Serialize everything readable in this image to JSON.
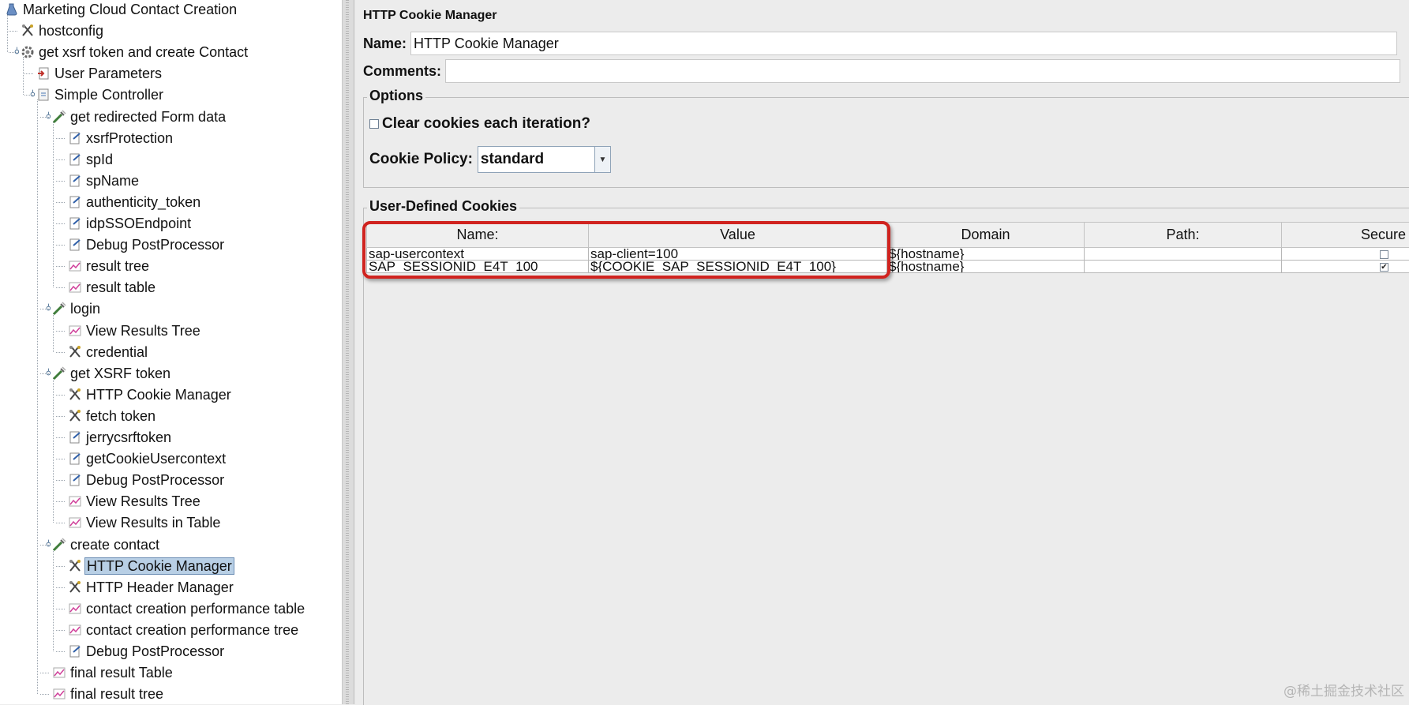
{
  "tree": {
    "items": [
      {
        "label": "Marketing Cloud Contact Creation",
        "icon": "testplan-icon"
      },
      {
        "label": "hostconfig",
        "icon": "config-element-icon"
      },
      {
        "label": "get xsrf token and create Contact",
        "icon": "thread-group-icon"
      },
      {
        "label": "User Parameters",
        "icon": "preprocessor-icon"
      },
      {
        "label": "Simple Controller",
        "icon": "controller-icon"
      },
      {
        "label": "get redirected Form data",
        "icon": "sampler-icon"
      },
      {
        "label": "xsrfProtection",
        "icon": "postprocessor-icon"
      },
      {
        "label": "spId",
        "icon": "postprocessor-icon"
      },
      {
        "label": "spName",
        "icon": "postprocessor-icon"
      },
      {
        "label": "authenticity_token",
        "icon": "postprocessor-icon"
      },
      {
        "label": "idpSSOEndpoint",
        "icon": "postprocessor-icon"
      },
      {
        "label": "Debug PostProcessor",
        "icon": "postprocessor-icon"
      },
      {
        "label": "result tree",
        "icon": "listener-icon"
      },
      {
        "label": "result table",
        "icon": "listener-icon"
      },
      {
        "label": "login",
        "icon": "sampler-icon"
      },
      {
        "label": "View Results Tree",
        "icon": "listener-icon"
      },
      {
        "label": "credential",
        "icon": "config-element-icon"
      },
      {
        "label": "get XSRF token",
        "icon": "sampler-icon"
      },
      {
        "label": "HTTP Cookie Manager",
        "icon": "config-element-icon"
      },
      {
        "label": "fetch token",
        "icon": "config-element-icon"
      },
      {
        "label": "jerrycsrftoken",
        "icon": "postprocessor-icon"
      },
      {
        "label": "getCookieUsercontext",
        "icon": "postprocessor-icon"
      },
      {
        "label": "Debug PostProcessor",
        "icon": "postprocessor-icon"
      },
      {
        "label": "View Results Tree",
        "icon": "listener-icon"
      },
      {
        "label": "View Results in Table",
        "icon": "listener-icon"
      },
      {
        "label": "create contact",
        "icon": "sampler-icon"
      },
      {
        "label": "HTTP Cookie Manager",
        "icon": "config-element-icon"
      },
      {
        "label": "HTTP Header Manager",
        "icon": "config-element-icon"
      },
      {
        "label": "contact creation performance table",
        "icon": "listener-icon"
      },
      {
        "label": "contact creation performance tree",
        "icon": "listener-icon"
      },
      {
        "label": "Debug PostProcessor",
        "icon": "postprocessor-icon"
      },
      {
        "label": "final result Table",
        "icon": "listener-icon"
      },
      {
        "label": "final result tree",
        "icon": "listener-icon"
      }
    ],
    "selected_index": 26
  },
  "panel": {
    "title": "HTTP Cookie Manager",
    "name_label": "Name:",
    "name_value": "HTTP Cookie Manager",
    "comments_label": "Comments:",
    "comments_value": "",
    "options": {
      "title": "Options",
      "clear_cookies_label": "Clear cookies each iteration?",
      "clear_cookies_checked": false,
      "cookie_policy_label": "Cookie Policy:",
      "cookie_policy_value": "standard"
    },
    "cookies": {
      "title": "User-Defined Cookies",
      "columns": [
        "Name:",
        "Value",
        "Domain",
        "Path:",
        "Secure"
      ],
      "rows": [
        {
          "name": "sap-usercontext",
          "value": "sap-client=100",
          "domain": "${hostname}",
          "path": "",
          "secure": false
        },
        {
          "name": "SAP_SESSIONID_E4T_100",
          "value": "${COOKIE_SAP_SESSIONID_E4T_100}",
          "domain": "${hostname}",
          "path": "",
          "secure": true
        }
      ]
    }
  },
  "watermark": "@稀土掘金技术社区",
  "colors": {
    "highlight": "#d0231f",
    "selection": "#b8cfe5",
    "background": "#ececec"
  }
}
